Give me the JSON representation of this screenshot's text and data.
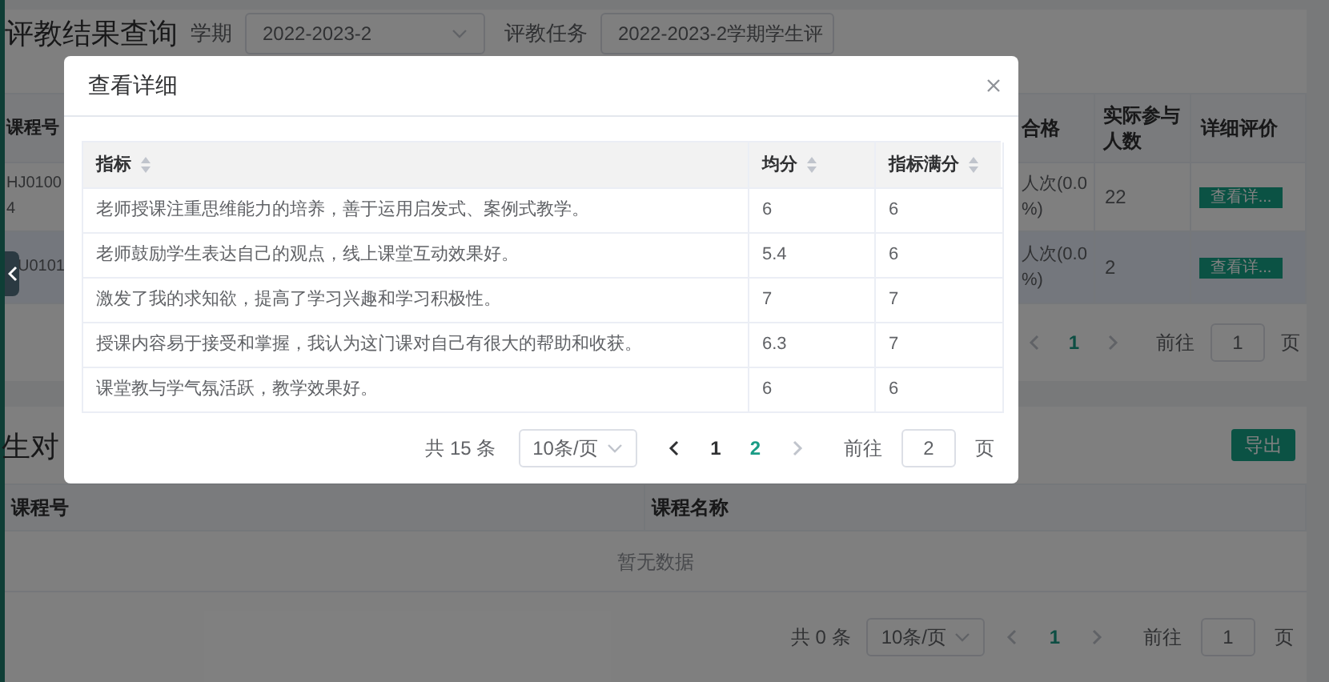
{
  "page": {
    "title": "评教结果查询",
    "filters": [
      {
        "label": "学期",
        "value": "2022-2023-2"
      },
      {
        "label": "评教任务",
        "value": "2022-2023-2学期学生评"
      }
    ],
    "results_table": {
      "columns": [
        "课程号",
        "合格",
        "实际参与人数",
        "详细评价"
      ],
      "rows": [
        {
          "course_no": [
            "HJ0100",
            "4"
          ],
          "fail": [
            "人次(0.0",
            "%)"
          ],
          "count": "22",
          "action": "查看详...",
          "selected": false
        },
        {
          "course_no": [
            "U0101"
          ],
          "fail": [
            "人次(0.0",
            "%)"
          ],
          "count": "2",
          "action": "查看详...",
          "selected": true
        }
      ],
      "pagination": {
        "page": "1",
        "goto_label": "前往",
        "goto": "1",
        "unit": "页"
      }
    },
    "second_section": {
      "title": "生对",
      "export_button": "导出",
      "columns": [
        "课程号",
        "课程名称"
      ],
      "empty_text": "暂无数据",
      "pagination": {
        "total": "共 0 条",
        "page_size": "10条/页",
        "page": "1",
        "goto_label": "前往",
        "goto": "1",
        "unit": "页"
      }
    }
  },
  "dialog": {
    "title": "查看详细",
    "columns": [
      "指标",
      "均分",
      "指标满分"
    ],
    "rows": [
      [
        "老师授课注重思维能力的培养，善于运用启发式、案例式教学。",
        "6",
        "6"
      ],
      [
        "老师鼓励学生表达自己的观点，线上课堂互动效果好。",
        "5.4",
        "6"
      ],
      [
        "激发了我的求知欲，提高了学习兴趣和学习积极性。",
        "7",
        "7"
      ],
      [
        "授课内容易于接受和掌握，我认为这门课对自己有很大的帮助和收获。",
        "6.3",
        "7"
      ],
      [
        "课堂教与学气氛活跃，教学效果好。",
        "6",
        "6"
      ]
    ],
    "pagination": {
      "total": "共 15 条",
      "page_size": "10条/页",
      "prev_disabled": false,
      "next_disabled": true,
      "pages": [
        {
          "label": "1",
          "selected": false
        },
        {
          "label": "2",
          "selected": true
        }
      ],
      "goto_label": "前往",
      "goto": "2",
      "unit": "页"
    }
  }
}
